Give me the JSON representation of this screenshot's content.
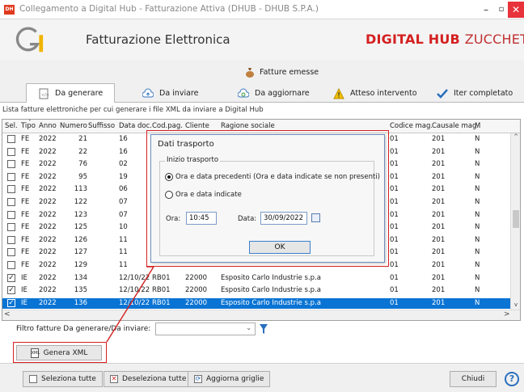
{
  "window": {
    "app_icon_text": "DH",
    "title": "Collegamento a Digital Hub - Fatturazione Attiva (DHUB - DHUB S.P.A.)",
    "min": "–",
    "max": "▫",
    "close": "✕"
  },
  "header": {
    "app_name": "Fatturazione Elettronica",
    "brand": "DIGITAL HUB",
    "brand_suffix": "ZUCCHETT"
  },
  "section": {
    "title": "Fatture emesse"
  },
  "tabs": [
    {
      "label": "Da generare",
      "active": true
    },
    {
      "label": "Da inviare"
    },
    {
      "label": "Da aggiornare"
    },
    {
      "label": "Atteso intervento"
    },
    {
      "label": "Iter completato"
    }
  ],
  "list": {
    "caption": "Lista fatture elettroniche per cui generare i file XML da inviare a Digital Hub",
    "columns": [
      "Sel.",
      "Tipo",
      "Anno",
      "Numero",
      "Suffisso",
      "Data doc.",
      "Cod.pag.",
      "Cliente",
      "Ragione sociale",
      "Codice mag.",
      "Causale mag.",
      "M"
    ],
    "sort_mark": "▾",
    "rows": [
      {
        "checked": false,
        "selected": false,
        "tipo": "FE",
        "anno": "2022",
        "numero": "21",
        "data": "16",
        "codpag": "",
        "cliente": "",
        "ragione": "",
        "codmag": "01",
        "causale": "201",
        "m": "N"
      },
      {
        "checked": false,
        "selected": false,
        "tipo": "FE",
        "anno": "2022",
        "numero": "22",
        "data": "16",
        "codpag": "",
        "cliente": "",
        "ragione": "",
        "codmag": "01",
        "causale": "201",
        "m": "N"
      },
      {
        "checked": false,
        "selected": false,
        "tipo": "FE",
        "anno": "2022",
        "numero": "76",
        "data": "02",
        "codpag": "",
        "cliente": "",
        "ragione": "",
        "codmag": "01",
        "causale": "201",
        "m": "N"
      },
      {
        "checked": false,
        "selected": false,
        "tipo": "FE",
        "anno": "2022",
        "numero": "95",
        "data": "19",
        "codpag": "",
        "cliente": "",
        "ragione": "",
        "codmag": "01",
        "causale": "201",
        "m": "N"
      },
      {
        "checked": false,
        "selected": false,
        "tipo": "FE",
        "anno": "2022",
        "numero": "113",
        "data": "06",
        "codpag": "",
        "cliente": "",
        "ragione": "",
        "codmag": "01",
        "causale": "201",
        "m": "N"
      },
      {
        "checked": false,
        "selected": false,
        "tipo": "FE",
        "anno": "2022",
        "numero": "122",
        "data": "07",
        "codpag": "",
        "cliente": "",
        "ragione": "",
        "codmag": "01",
        "causale": "201",
        "m": "N"
      },
      {
        "checked": false,
        "selected": false,
        "tipo": "FE",
        "anno": "2022",
        "numero": "123",
        "data": "07",
        "codpag": "",
        "cliente": "",
        "ragione": "",
        "codmag": "01",
        "causale": "201",
        "m": "N"
      },
      {
        "checked": false,
        "selected": false,
        "tipo": "FE",
        "anno": "2022",
        "numero": "125",
        "data": "10",
        "codpag": "",
        "cliente": "",
        "ragione": "",
        "codmag": "01",
        "causale": "201",
        "m": "N"
      },
      {
        "checked": false,
        "selected": false,
        "tipo": "FE",
        "anno": "2022",
        "numero": "126",
        "data": "11",
        "codpag": "",
        "cliente": "",
        "ragione": "",
        "codmag": "01",
        "causale": "201",
        "m": "N"
      },
      {
        "checked": false,
        "selected": false,
        "tipo": "FE",
        "anno": "2022",
        "numero": "127",
        "data": "11",
        "codpag": "",
        "cliente": "",
        "ragione": "",
        "codmag": "01",
        "causale": "201",
        "m": "N"
      },
      {
        "checked": false,
        "selected": false,
        "tipo": "FE",
        "anno": "2022",
        "numero": "129",
        "data": "11",
        "codpag": "",
        "cliente": "",
        "ragione": "",
        "codmag": "01",
        "causale": "201",
        "m": "N"
      },
      {
        "checked": true,
        "selected": false,
        "tipo": "IE",
        "anno": "2022",
        "numero": "134",
        "data": "12/10/22",
        "codpag": "RB01",
        "cliente": "22000",
        "ragione": "Esposito Carlo Industrie s.p.a",
        "codmag": "01",
        "causale": "201",
        "m": "N"
      },
      {
        "checked": true,
        "selected": false,
        "tipo": "IE",
        "anno": "2022",
        "numero": "135",
        "data": "12/10/22",
        "codpag": "RB01",
        "cliente": "22000",
        "ragione": "Esposito Carlo Industrie s.p.a",
        "codmag": "01",
        "causale": "201",
        "m": "N"
      },
      {
        "checked": true,
        "selected": true,
        "tipo": "IE",
        "anno": "2022",
        "numero": "136",
        "data": "12/10/22",
        "codpag": "RB01",
        "cliente": "22000",
        "ragione": "Esposito Carlo Industrie s.p.a",
        "codmag": "01",
        "causale": "201",
        "m": "N"
      }
    ],
    "scroll_left": "<",
    "scroll_right": ">",
    "scroll_up": "^",
    "scroll_down": "v"
  },
  "filter": {
    "label": "Filtro fatture Da generare/Da inviare:",
    "value": ""
  },
  "generate_button": {
    "label": "Genera XML",
    "icon": "XML"
  },
  "bottom": {
    "select_all": "Seleziona tutte",
    "deselect_all": "Deseleziona tutte",
    "refresh": "Aggiorna griglie",
    "close": "Chiudi",
    "help": "?"
  },
  "dialog": {
    "title": "Dati trasporto",
    "group_label": "Inizio trasporto",
    "option_previous": "Ora e data precedenti (Ora e data indicate se non presenti)",
    "option_indicated": "Ora e data indicate",
    "selected_option": "previous",
    "time_label": "Ora:",
    "time_value": "10:45",
    "date_label": "Data:",
    "date_value": "30/09/2022",
    "ok": "OK"
  },
  "colors": {
    "accent_red": "#d42020",
    "selection_blue": "#0a74d4",
    "help_blue": "#2a6fbf"
  }
}
